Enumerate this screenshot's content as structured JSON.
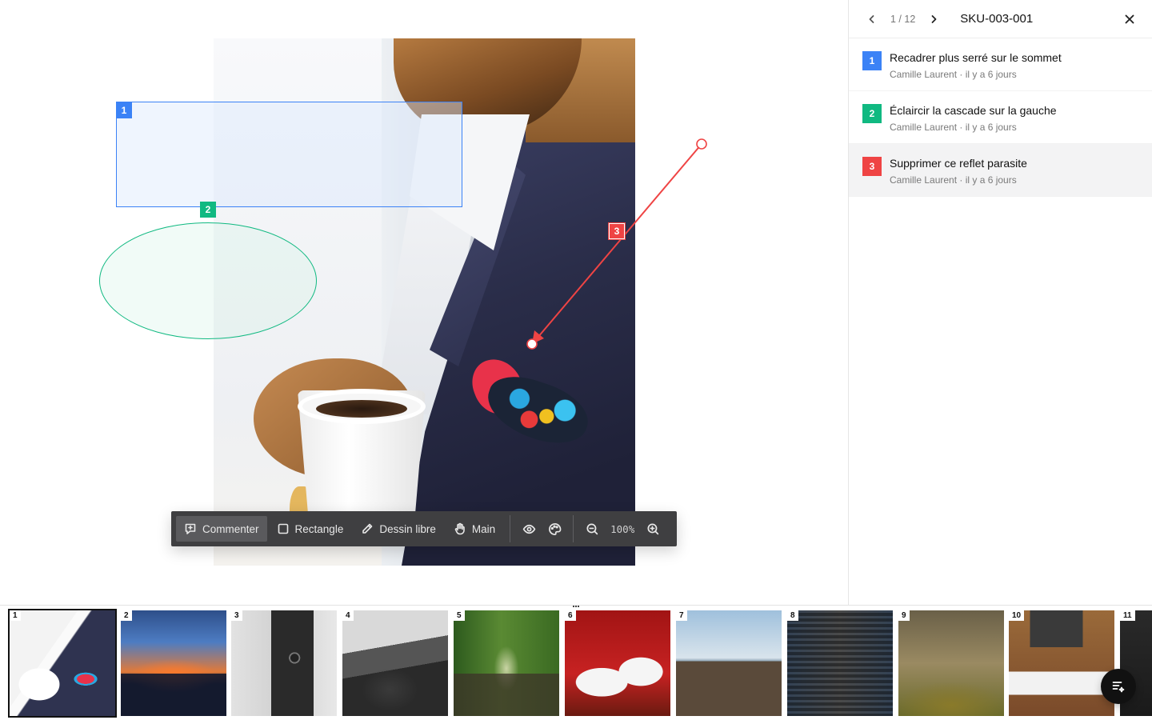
{
  "header": {
    "position_label": "1 / 12",
    "sku": "SKU-003-001"
  },
  "annotations": [
    {
      "number": "1",
      "shape": "rectangle",
      "color": "#3b82f6"
    },
    {
      "number": "2",
      "shape": "ellipse",
      "color": "#10b981"
    },
    {
      "number": "3",
      "shape": "arrow",
      "color": "#ef4444"
    }
  ],
  "comments": [
    {
      "number": "1",
      "text": "Recadrer plus serré sur le sommet",
      "meta": "Camille Laurent · il y a 6 jours",
      "color": "#3b82f6"
    },
    {
      "number": "2",
      "text": "Éclaircir la cascade sur la gauche",
      "meta": "Camille Laurent · il y a 6 jours",
      "color": "#10b981"
    },
    {
      "number": "3",
      "text": "Supprimer ce reflet parasite",
      "meta": "Camille Laurent · il y a 6 jours",
      "color": "#ef4444",
      "selected": true
    }
  ],
  "toolbar": {
    "comment_label": "Commenter",
    "rectangle_label": "Rectangle",
    "draw_label": "Dessin libre",
    "hand_label": "Main",
    "zoom_level": "100%",
    "active_tool": "Commenter"
  },
  "thumbnails": [
    {
      "number": "1",
      "subject": "man-with-coffee",
      "active": true
    },
    {
      "number": "2",
      "subject": "city-sunset"
    },
    {
      "number": "3",
      "subject": "vintage-camera"
    },
    {
      "number": "4",
      "subject": "car-interior"
    },
    {
      "number": "5",
      "subject": "railway-forest"
    },
    {
      "number": "6",
      "subject": "white-heels"
    },
    {
      "number": "7",
      "subject": "pier"
    },
    {
      "number": "8",
      "subject": "railway-bridge"
    },
    {
      "number": "9",
      "subject": "hill-landscape"
    },
    {
      "number": "10",
      "subject": "desk-flatlay"
    },
    {
      "number": "11",
      "subject": "dark-partial"
    }
  ],
  "icons": {
    "prev": "chevron-left-icon",
    "next": "chevron-right-icon",
    "close": "close-icon",
    "comment": "comment-plus-icon",
    "rectangle": "square-icon",
    "draw": "pencil-icon",
    "hand": "hand-icon",
    "visibility": "eye-icon",
    "palette": "palette-icon",
    "zoom_out": "zoom-out-icon",
    "zoom_in": "zoom-in-icon",
    "fab": "list-sparkle-icon"
  }
}
